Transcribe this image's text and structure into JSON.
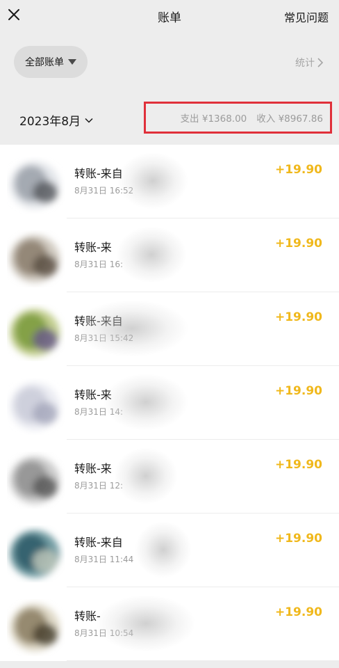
{
  "nav": {
    "close_icon": "close-icon",
    "title": "账单",
    "faq": "常见问题"
  },
  "filter": {
    "label": "全部账单",
    "stats": "统计"
  },
  "month": {
    "label": "2023年8月",
    "summary_expense": "支出 ¥1368.00",
    "summary_income": "收入 ¥8967.86"
  },
  "colors": {
    "accent_income": "#f0b81c",
    "highlight_border": "#e0303a",
    "background": "#ededed"
  },
  "transactions": [
    {
      "title": "转账-来自",
      "time": "8月31日 16:52",
      "amount": "+19.90",
      "avatar_colors": [
        "#9aa0a8",
        "#dfe3e8",
        "#5b5d62"
      ]
    },
    {
      "title": "转账-来",
      "time": "8月31日 16:",
      "amount": "+19.90",
      "avatar_colors": [
        "#8a7c6c",
        "#c9c2b6",
        "#5e5346"
      ]
    },
    {
      "title": "转账-来自",
      "time": "8月31日 15:42",
      "amount": "+19.90",
      "avatar_colors": [
        "#7a9a3a",
        "#b8c77c",
        "#6b5d8a"
      ]
    },
    {
      "title": "转账-来",
      "time": "8月31日 14:",
      "amount": "+19.90",
      "avatar_colors": [
        "#c9cbd8",
        "#e8e9f0",
        "#a7a9bd"
      ]
    },
    {
      "title": "转账-来",
      "time": "8月31日 12:",
      "amount": "+19.90",
      "avatar_colors": [
        "#8f8f8f",
        "#c4c4c4",
        "#5a5a5a"
      ]
    },
    {
      "title": "转账-来自",
      "time": "8月31日 11:44",
      "amount": "+19.90",
      "avatar_colors": [
        "#2d5a66",
        "#5a8b93",
        "#bcc6b8"
      ]
    },
    {
      "title": "转账-",
      "time": "8月31日 10:54",
      "amount": "+19.90",
      "avatar_colors": [
        "#8a7d60",
        "#d9d2bd",
        "#4b4433"
      ]
    }
  ]
}
